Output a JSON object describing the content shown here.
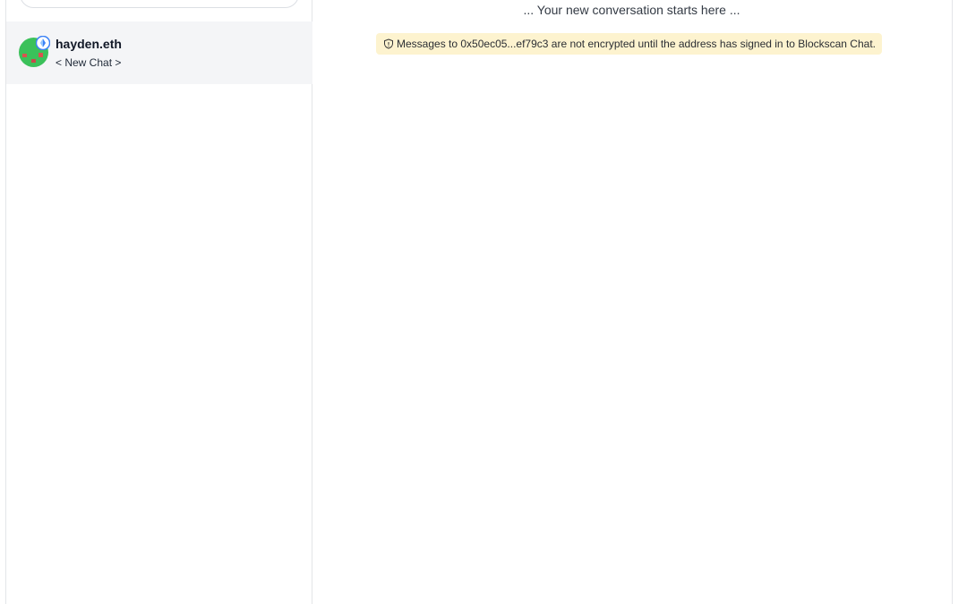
{
  "sidebar": {
    "chats": [
      {
        "name": "hayden.eth",
        "preview": "< New Chat >",
        "avatar_icon": "avatar-identicon",
        "badge_icon": "ethereum-verified-icon"
      }
    ]
  },
  "conversation": {
    "start_text": "... Your new conversation starts here ...",
    "encryption_notice": {
      "icon": "shield-icon",
      "text": "Messages to 0x50ec05...ef79c3 are not encrypted until the address has signed in to Blockscan Chat."
    }
  },
  "colors": {
    "selected_row_bg": "#f4f5f7",
    "notice_bg": "#fdf3cf",
    "avatar_green": "#3bc15a",
    "avatar_red": "#e2585b",
    "verified_blue": "#3b82f6"
  }
}
